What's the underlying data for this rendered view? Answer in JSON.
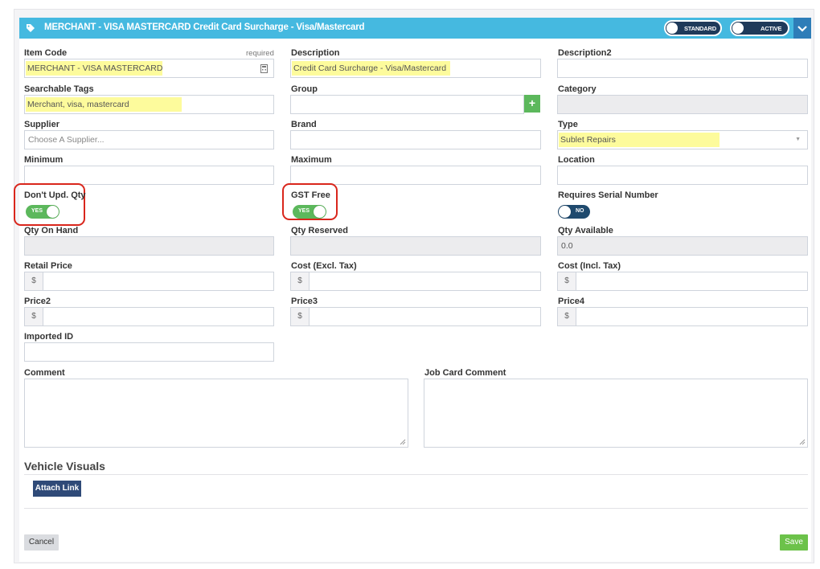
{
  "header": {
    "title": "MERCHANT - VISA MASTERCARD Credit Card Surcharge - Visa/Mastercard",
    "standard_label": "STANDARD",
    "active_label": "ACTIVE",
    "accent_color": "#45b9e0"
  },
  "fields": {
    "item_code": {
      "label": "Item Code",
      "required": "required",
      "value": "MERCHANT - VISA MASTERCARD"
    },
    "description": {
      "label": "Description",
      "value": "Credit Card Surcharge - Visa/Mastercard"
    },
    "description2": {
      "label": "Description2",
      "value": ""
    },
    "tags": {
      "label": "Searchable Tags",
      "value": "Merchant, visa, mastercard"
    },
    "group": {
      "label": "Group",
      "value": ""
    },
    "category": {
      "label": "Category",
      "value": ""
    },
    "supplier": {
      "label": "Supplier",
      "placeholder": "Choose A Supplier..."
    },
    "brand": {
      "label": "Brand",
      "value": ""
    },
    "type": {
      "label": "Type",
      "value": "Sublet Repairs"
    },
    "minimum": {
      "label": "Minimum",
      "value": ""
    },
    "maximum": {
      "label": "Maximum",
      "value": ""
    },
    "location": {
      "label": "Location",
      "value": ""
    },
    "dont_upd_qty": {
      "label": "Don't Upd. Qty",
      "state": "YES"
    },
    "gst_free": {
      "label": "GST Free",
      "state": "YES"
    },
    "serial": {
      "label": "Requires Serial Number",
      "state": "NO"
    },
    "qty_on_hand": {
      "label": "Qty On Hand",
      "value": ""
    },
    "qty_reserved": {
      "label": "Qty Reserved",
      "value": ""
    },
    "qty_available": {
      "label": "Qty Available",
      "value": "0.0"
    },
    "retail_price": {
      "label": "Retail Price",
      "prefix": "$"
    },
    "cost_excl": {
      "label": "Cost (Excl. Tax)",
      "prefix": "$"
    },
    "cost_incl": {
      "label": "Cost (Incl. Tax)",
      "prefix": "$"
    },
    "price2": {
      "label": "Price2",
      "prefix": "$"
    },
    "price3": {
      "label": "Price3",
      "prefix": "$"
    },
    "price4": {
      "label": "Price4",
      "prefix": "$"
    },
    "imported_id": {
      "label": "Imported ID",
      "value": ""
    },
    "comment": {
      "label": "Comment",
      "value": ""
    },
    "job_card_comment": {
      "label": "Job Card Comment",
      "value": ""
    }
  },
  "vehicle_visuals": {
    "title": "Vehicle Visuals",
    "attach_label": "Attach Link"
  },
  "footer": {
    "cancel_label": "Cancel",
    "save_label": "Save"
  }
}
